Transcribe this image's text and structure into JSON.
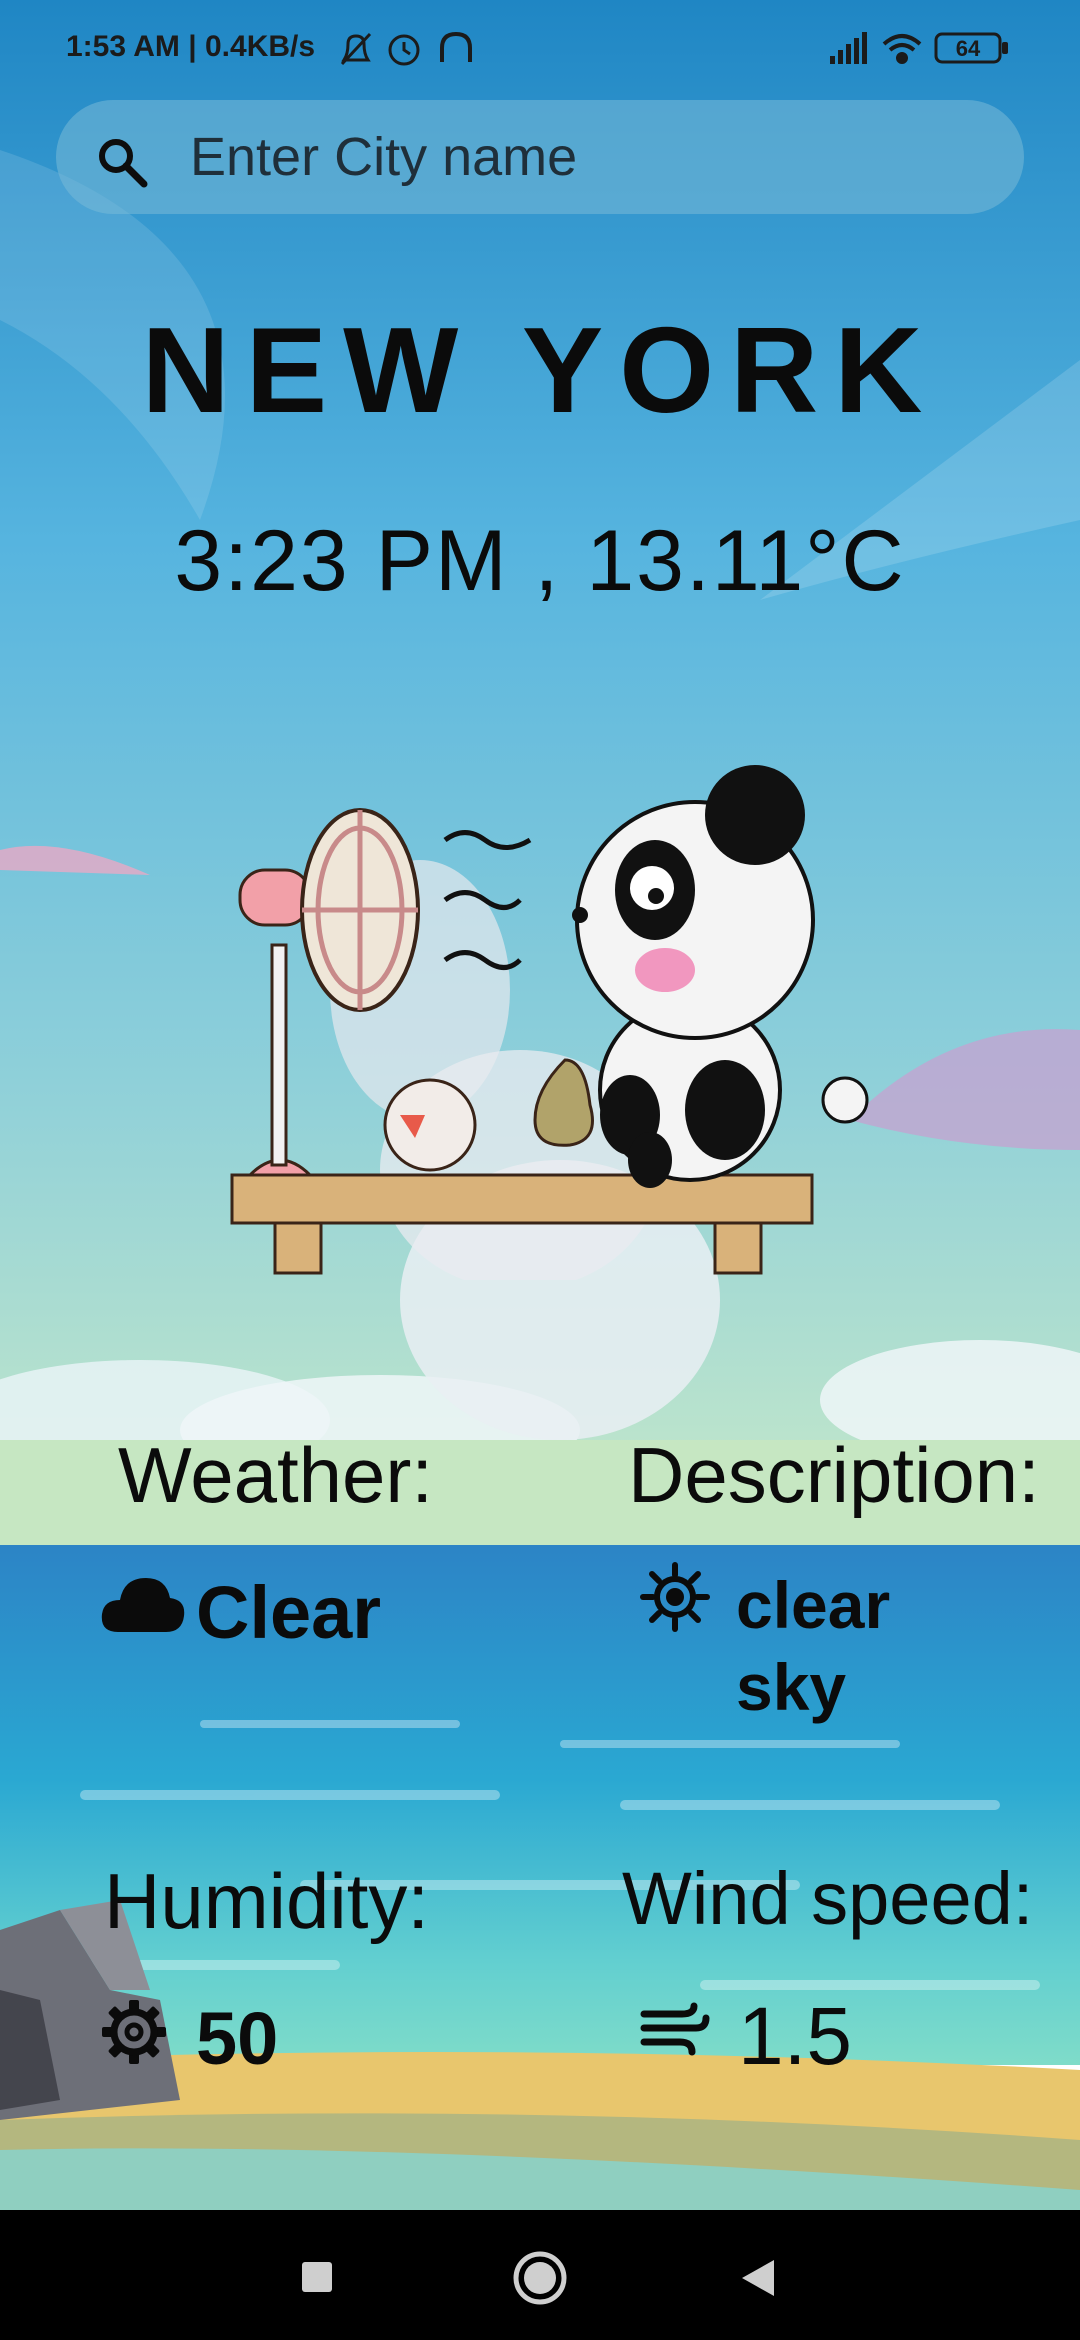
{
  "status_bar": {
    "time_speed": "1:53 AM | 0.4KB/s",
    "battery": "64",
    "icons": [
      "muted-bell-icon",
      "alarm-icon",
      "headphones-icon",
      "signal-icon",
      "wifi-icon",
      "battery-icon"
    ]
  },
  "search": {
    "placeholder": "Enter City name",
    "value": ""
  },
  "city": "NEW YORK",
  "time_temp": "3:23 PM , 13.11°C",
  "weather": {
    "label": "Weather:",
    "value": "Clear",
    "icon": "cloud-icon"
  },
  "description": {
    "label": "Description:",
    "line1": "clear",
    "line2": "sky",
    "icon": "sun-icon"
  },
  "humidity": {
    "label": "Humidity:",
    "value": "50",
    "icon": "gear-icon"
  },
  "wind": {
    "label": "Wind speed:",
    "value": "1.5",
    "icon": "wind-icon"
  },
  "nav": [
    "recent-apps-button",
    "home-button",
    "back-button"
  ]
}
